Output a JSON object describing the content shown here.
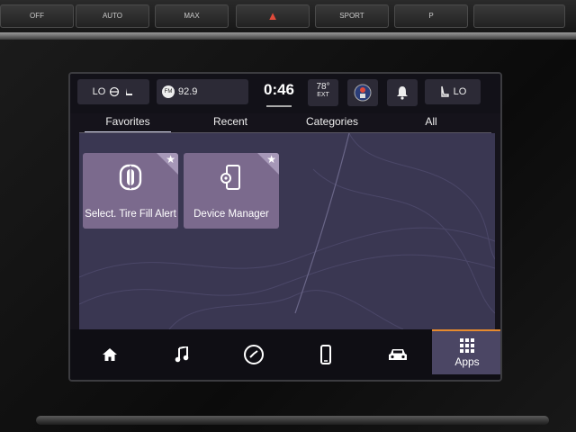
{
  "hardware": {
    "buttons": [
      {
        "name": "defrost-rear-button",
        "label": "OFF"
      },
      {
        "name": "seat-heat-button",
        "label": "AUTO"
      },
      {
        "name": "front-defrost-button",
        "label": "MAX"
      },
      {
        "name": "hazard-button",
        "label": "▲"
      },
      {
        "name": "sport-mode-button",
        "label": "SPORT"
      },
      {
        "name": "park-assist-button",
        "label": "P"
      },
      {
        "name": "lane-keep-button",
        "label": ""
      }
    ]
  },
  "status_bar": {
    "climate_left": "LO",
    "radio_band": "FM",
    "radio_station": "92.9",
    "time": "0:46",
    "outside_temp": "78°",
    "outside_temp_label": "EXT",
    "climate_right": "LO"
  },
  "tabs": [
    {
      "label": "Favorites",
      "active": true
    },
    {
      "label": "Recent",
      "active": false
    },
    {
      "label": "Categories",
      "active": false
    },
    {
      "label": "All",
      "active": false
    }
  ],
  "tiles": [
    {
      "label": "Select. Tire Fill Alert",
      "icon": "tire-icon",
      "favorite": true
    },
    {
      "label": "Device Manager",
      "icon": "device-manager-icon",
      "favorite": true
    }
  ],
  "nav": {
    "items": [
      {
        "name": "nav-home",
        "icon": "home-icon"
      },
      {
        "name": "nav-media",
        "icon": "music-note-icon"
      },
      {
        "name": "nav-comfort",
        "icon": "climate-icon"
      },
      {
        "name": "nav-phone",
        "icon": "phone-icon"
      },
      {
        "name": "nav-vehicle",
        "icon": "car-icon"
      }
    ],
    "apps_label": "Apps"
  },
  "colors": {
    "accent": "#e68a2e",
    "tile": "#7b6a8d",
    "content_bg": "#3a3752"
  }
}
